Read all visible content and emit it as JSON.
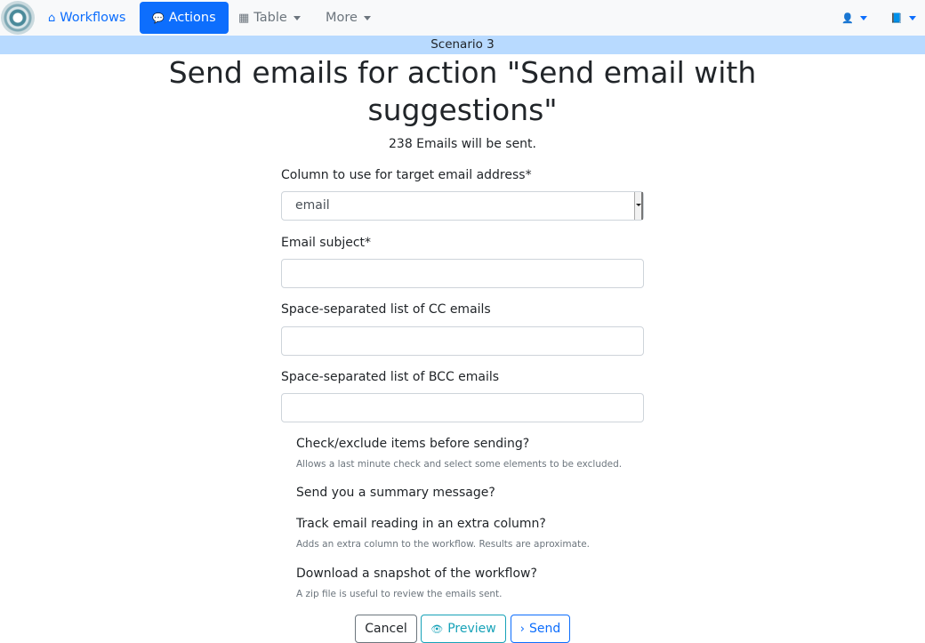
{
  "navbar": {
    "workflows": {
      "icon": "home-icon",
      "glyph": "⌂",
      "label": "Workflows"
    },
    "actions": {
      "icon": "comments-icon",
      "glyph": "💬",
      "label": "Actions"
    },
    "table": {
      "icon": "table-icon",
      "glyph": "▦",
      "label": "Table"
    },
    "more": {
      "label": "More"
    },
    "user": {
      "icon": "user-icon",
      "glyph": "👤"
    },
    "book": {
      "icon": "book-icon",
      "glyph": "📘"
    }
  },
  "scenario": "Scenario 3",
  "page": {
    "title": "Send emails for action \"Send email with suggestions\"",
    "count_text": "238 Emails will be sent."
  },
  "form": {
    "target_column": {
      "label": "Column to use for target email address*",
      "value": "email"
    },
    "subject": {
      "label": "Email subject*",
      "value": ""
    },
    "cc": {
      "label": "Space-separated list of CC emails",
      "value": ""
    },
    "bcc": {
      "label": "Space-separated list of BCC emails",
      "value": ""
    },
    "check_exclude": {
      "label": "Check/exclude items before sending?",
      "help": "Allows a last minute check and select some elements to be excluded."
    },
    "summary": {
      "label": "Send you a summary message?"
    },
    "track": {
      "label": "Track email reading in an extra column?",
      "help": "Adds an extra column to the workflow. Results are aproximate."
    },
    "snapshot": {
      "label": "Download a snapshot of the workflow?",
      "help": "A zip file is useful to review the emails sent."
    }
  },
  "buttons": {
    "cancel": "Cancel",
    "preview": {
      "icon": "eye-icon",
      "glyph": "👁",
      "label": "Preview"
    },
    "send": {
      "icon": "chevron-right-icon",
      "glyph": "›",
      "label": "Send"
    }
  }
}
